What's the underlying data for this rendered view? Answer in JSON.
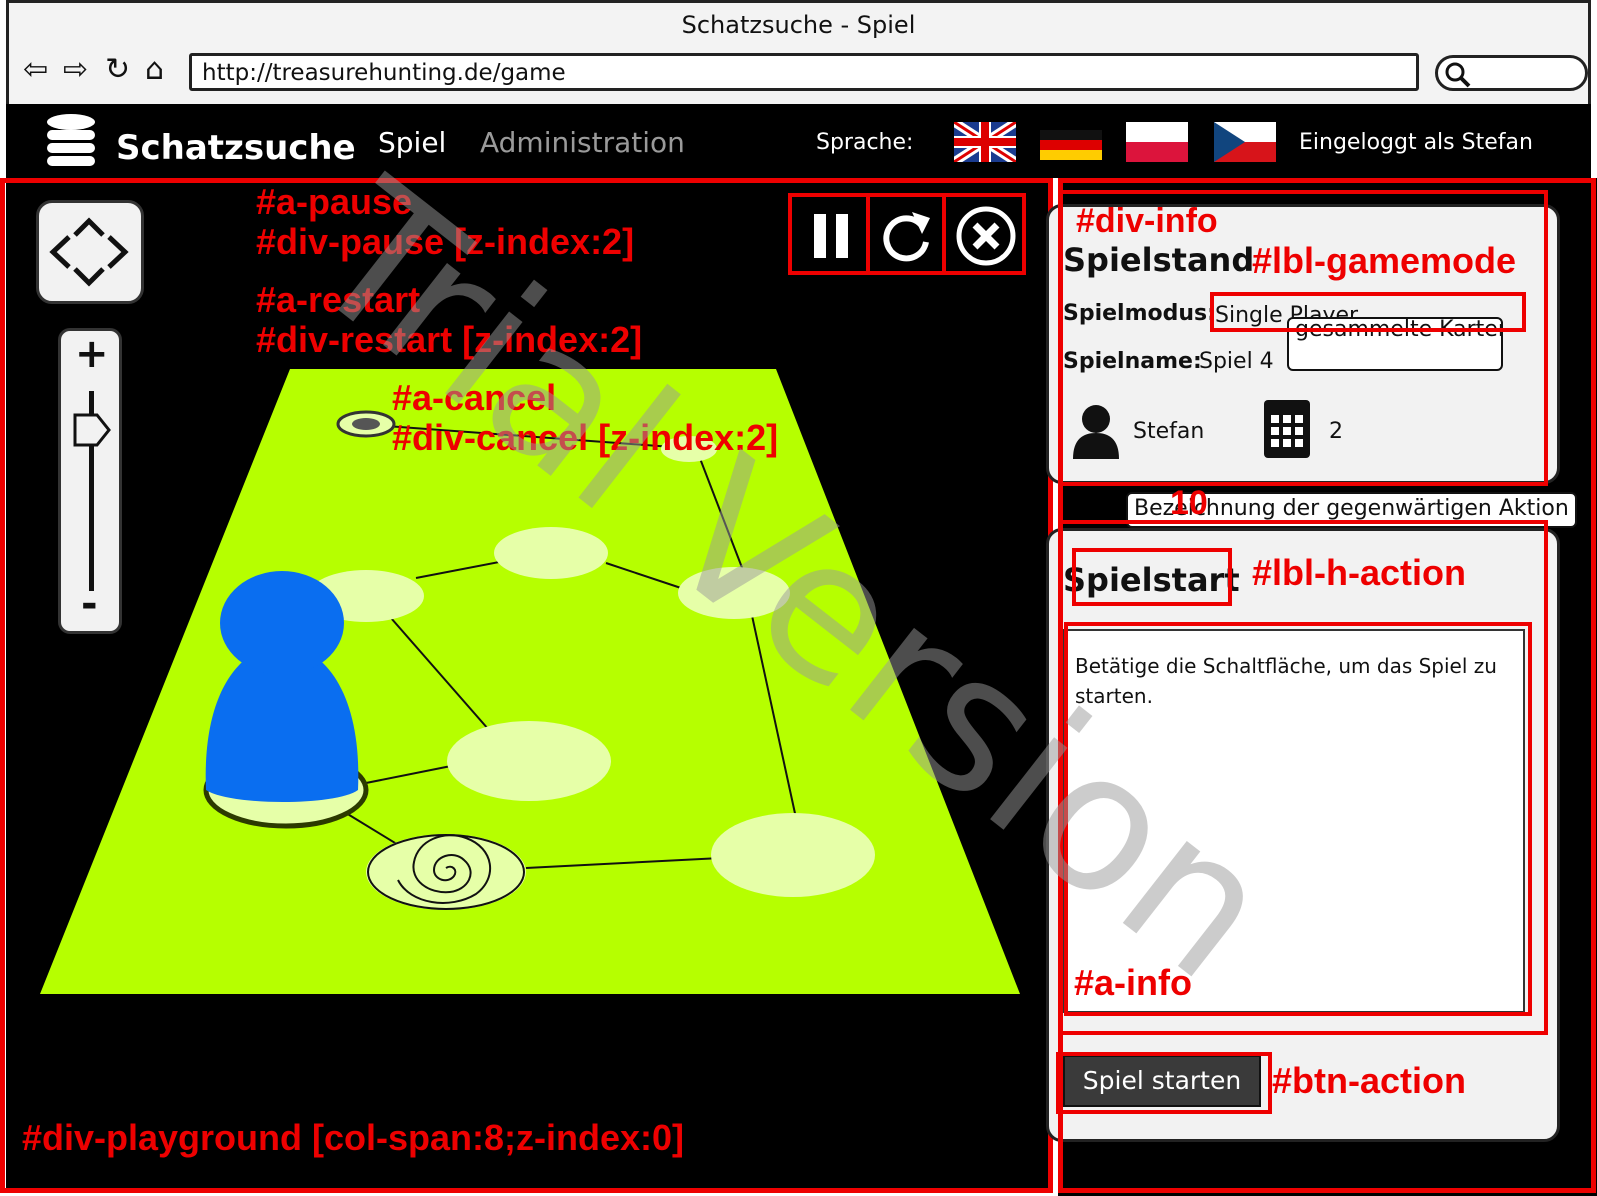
{
  "browser": {
    "window_title": "Schatzsuche - Spiel",
    "url": "http://treasurehunting.de/game",
    "icons": [
      "back-icon",
      "forward-icon",
      "reload-icon",
      "home-icon",
      "search-icon"
    ]
  },
  "navbar": {
    "brand": "Schatzsuche",
    "menu": [
      {
        "label": "Spiel",
        "active": true
      },
      {
        "label": "Administration",
        "active": false
      }
    ],
    "language_label": "Sprache:",
    "flags": [
      "uk-flag",
      "german-flag",
      "polish-flag",
      "czech-flag"
    ],
    "user_status": "Eingeloggt als Stefan"
  },
  "playground": {
    "controls": {
      "zoom_in": "+",
      "zoom_out": "-"
    },
    "toolbar": [
      "pause-icon",
      "restart-icon",
      "cancel-icon"
    ]
  },
  "info_card": {
    "title": "Spielstand",
    "mode_label": "Spielmodus:",
    "mode_value": "Single Player",
    "name_label": "Spielname:",
    "name_value": "Spiel 4",
    "player": "Stefan",
    "cards_count": "2",
    "cards_tooltip": "gesammelte Karten"
  },
  "action_card": {
    "tooltip": "Bezeichnung der gegenwärtigen Aktion",
    "heading": "Spielstart",
    "text": "Betätige die Schaltfläche, um das Spiel zu starten.",
    "button": "Spiel starten"
  },
  "annotations": {
    "a_pause": "#a-pause",
    "div_pause": "#div-pause [z-index:2]",
    "a_restart": "#a-restart",
    "div_restart": "#div-restart [z-index:2]",
    "a_cancel": "#a-cancel",
    "div_cancel": "#div-cancel [z-index:2]",
    "div_playground": "#div-playground [col-span:8;z-index:0]",
    "div_info": "#div-info",
    "lbl_gamemode": "#lbl-gamemode",
    "num_10": "10",
    "lbl_h_action": "#lbl-h-action",
    "a_info": "#a-info",
    "btn_action": "#btn-action"
  },
  "watermark": "Trial Version",
  "colors": {
    "board": "#b6ff00",
    "pawn": "#0a6ef0",
    "annotation": "#e00000"
  }
}
